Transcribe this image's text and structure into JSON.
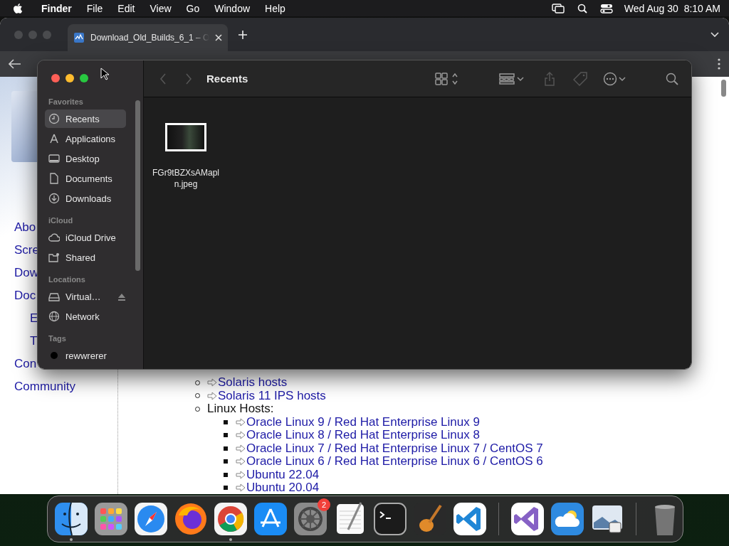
{
  "menu_bar": {
    "app_name": "Finder",
    "menus": [
      "File",
      "Edit",
      "View",
      "Go",
      "Window",
      "Help"
    ],
    "clock": "Wed Aug 30  8:10 AM"
  },
  "browser": {
    "tabs": [
      {
        "title": "Download_Old_Builds_6_1 – O",
        "selected": true
      }
    ],
    "page": {
      "nav": [
        {
          "label": "Abo"
        },
        {
          "label": "Scre"
        },
        {
          "label": "Dow"
        },
        {
          "label": "Doc",
          "children": [
            {
              "label": "E"
            },
            {
              "label": "T"
            }
          ]
        },
        {
          "label": "Con"
        },
        {
          "label": "Community"
        }
      ],
      "hosts": [
        {
          "kind": "link",
          "label": "Solaris hosts"
        },
        {
          "kind": "link",
          "label": "Solaris 11 IPS hosts"
        },
        {
          "kind": "group",
          "label": "Linux Hosts:",
          "children": [
            {
              "kind": "link",
              "label": "Oracle Linux 9 / Red Hat Enterprise Linux 9"
            },
            {
              "kind": "link",
              "label": "Oracle Linux 8 / Red Hat Enterprise Linux 8"
            },
            {
              "kind": "link",
              "label": "Oracle Linux 7 / Red Hat Enterprise Linux 7 / CentOS 7"
            },
            {
              "kind": "link",
              "label": "Oracle Linux 6 / Red Hat Enterprise Linux 6 / CentOS 6"
            },
            {
              "kind": "link",
              "label": "Ubuntu 22.04"
            },
            {
              "kind": "link",
              "label": "Ubuntu 20.04"
            }
          ]
        }
      ]
    }
  },
  "finder": {
    "title": "Recents",
    "sidebar": [
      {
        "heading": "Favorites",
        "items": [
          {
            "label": "Recents",
            "selected": true
          },
          {
            "label": "Applications",
            "selected": false
          },
          {
            "label": "Desktop",
            "selected": false
          },
          {
            "label": "Documents",
            "selected": false
          },
          {
            "label": "Downloads",
            "selected": false
          }
        ]
      },
      {
        "heading": "iCloud",
        "items": [
          {
            "label": "iCloud Drive",
            "selected": false
          },
          {
            "label": "Shared",
            "selected": false
          }
        ]
      },
      {
        "heading": "Locations",
        "items": [
          {
            "label": "Virtual…",
            "selected": false,
            "ejectable": true
          },
          {
            "label": "Network",
            "selected": false,
            "ejectable": false
          }
        ]
      },
      {
        "heading": "Tags",
        "items": [
          {
            "label": "rewwrerer",
            "selected": false
          }
        ]
      }
    ],
    "files": [
      {
        "name": "FGr9tBZXsAMapln.jpeg",
        "selected": false
      }
    ]
  },
  "dock": [
    {
      "running": true
    },
    {
      "running": false
    },
    {
      "running": false
    },
    {
      "running": false
    },
    {
      "running": true
    },
    {
      "running": false
    },
    {
      "running": false,
      "badge": "2"
    },
    {
      "running": false
    },
    {
      "running": false
    },
    {
      "running": false
    },
    {
      "running": false
    },
    {
      "running": false
    },
    {
      "running": false
    },
    {
      "running": false
    },
    {
      "running": false
    }
  ]
}
